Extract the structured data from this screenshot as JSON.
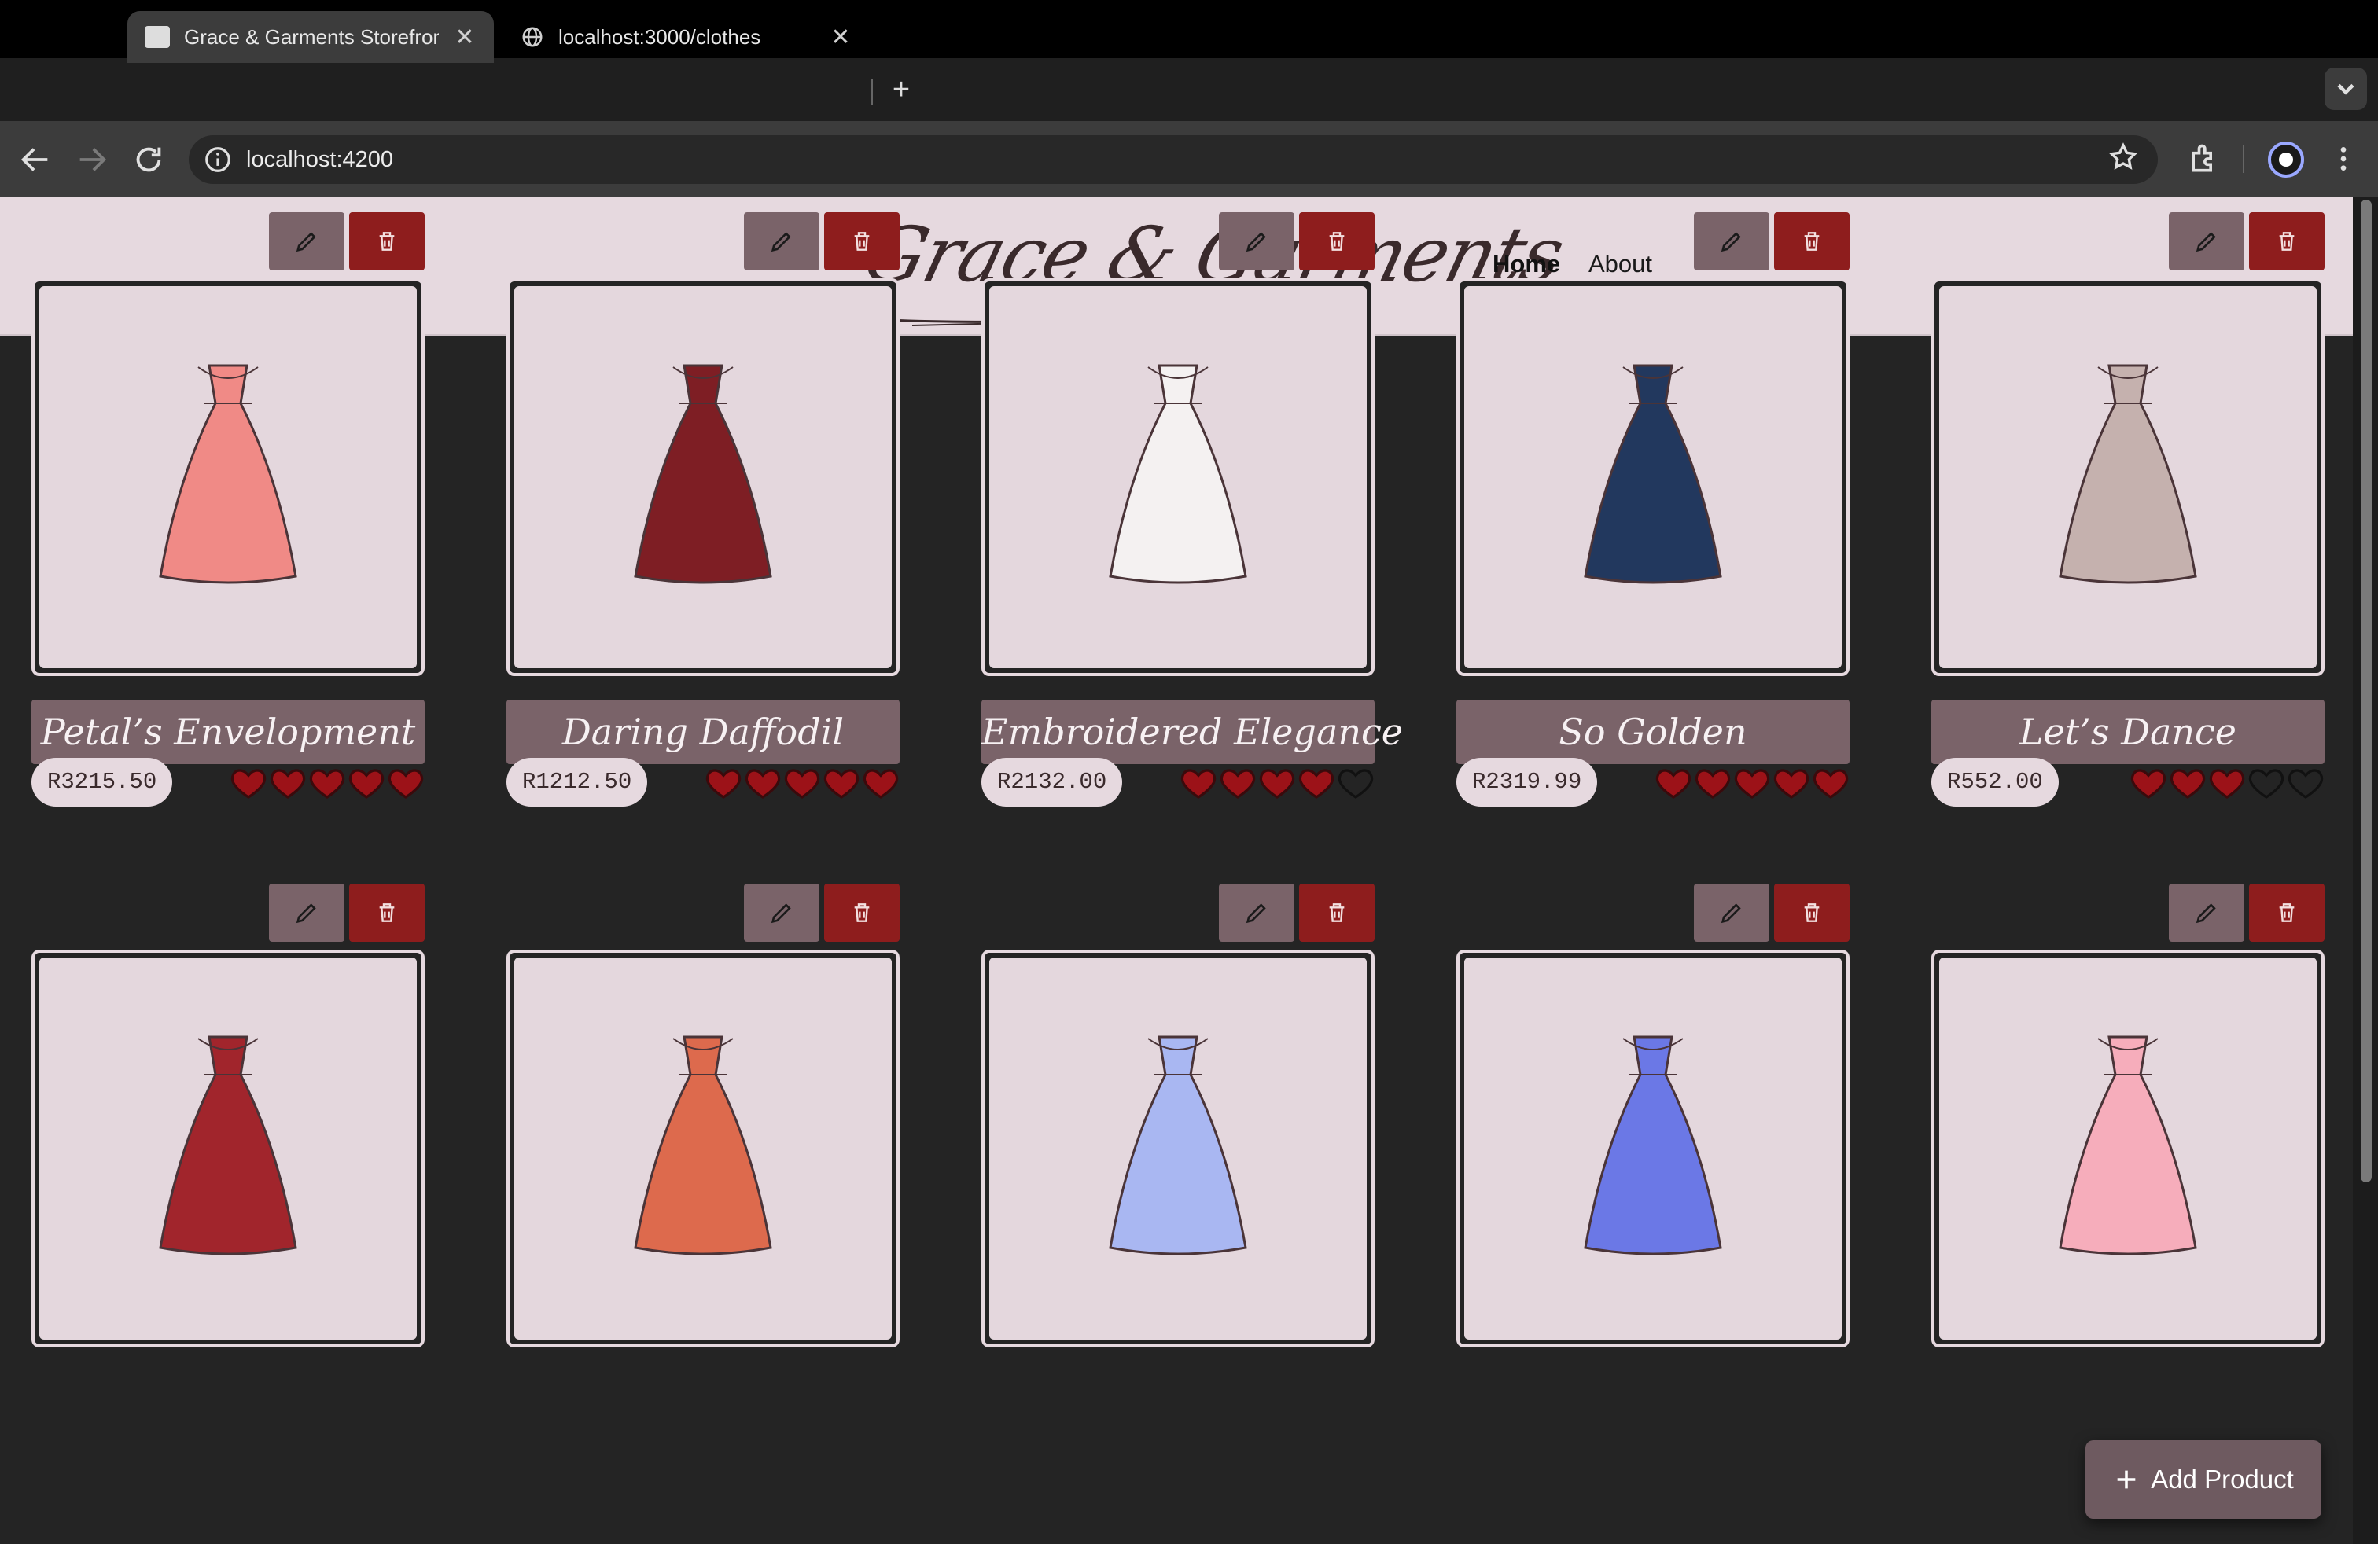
{
  "browser": {
    "tabs": [
      {
        "title": "Grace & Garments Storefront",
        "active": true
      },
      {
        "title": "localhost:3000/clothes",
        "active": false
      }
    ],
    "url": "localhost:4200"
  },
  "header": {
    "logo_text": "Grace & Garments",
    "nav": [
      {
        "label": "Home",
        "active": true
      },
      {
        "label": "About",
        "active": false
      }
    ]
  },
  "products": [
    {
      "name": "Petal’s Envelopment",
      "price": "R3215.50",
      "rating": 5,
      "icon": "pink-tiered-gown",
      "color": "#f08a86"
    },
    {
      "name": "Daring Daffodil",
      "price": "R1212.50",
      "rating": 5,
      "icon": "maroon-long-sleeve-gown",
      "color": "#7e1e24"
    },
    {
      "name": "Embroidered Elegance",
      "price": "R2132.00",
      "rating": 4,
      "icon": "white-lace-mermaid-gown",
      "color": "#f4f1f1"
    },
    {
      "name": "So Golden",
      "price": "R2319.99",
      "rating": 5,
      "icon": "navy-wrap-dress",
      "color": "#22385e"
    },
    {
      "name": "Let’s Dance",
      "price": "R552.00",
      "rating": 3,
      "icon": "taupe-ruffle-gown",
      "color": "#c5b1ae"
    },
    {
      "name": "",
      "price": "",
      "rating": 0,
      "icon": "red-v-neck-dress",
      "color": "#a1252c"
    },
    {
      "name": "",
      "price": "",
      "rating": 0,
      "icon": "orange-patterned-dress",
      "color": "#dd6a4d"
    },
    {
      "name": "",
      "price": "",
      "rating": 0,
      "icon": "light-blue-sheath-dress",
      "color": "#a9b7f2"
    },
    {
      "name": "",
      "price": "",
      "rating": 0,
      "icon": "periwinkle-jumpsuit",
      "color": "#6b78e6"
    },
    {
      "name": "",
      "price": "",
      "rating": 0,
      "icon": "pink-floral-dress",
      "color": "#f6adbb"
    }
  ],
  "fab": {
    "label": "Add Product"
  },
  "colors": {
    "heart_filled": "#9c1218",
    "card_bg": "#e4d7dd",
    "name_bar": "#7a6369",
    "delete": "#8e1d1d"
  }
}
